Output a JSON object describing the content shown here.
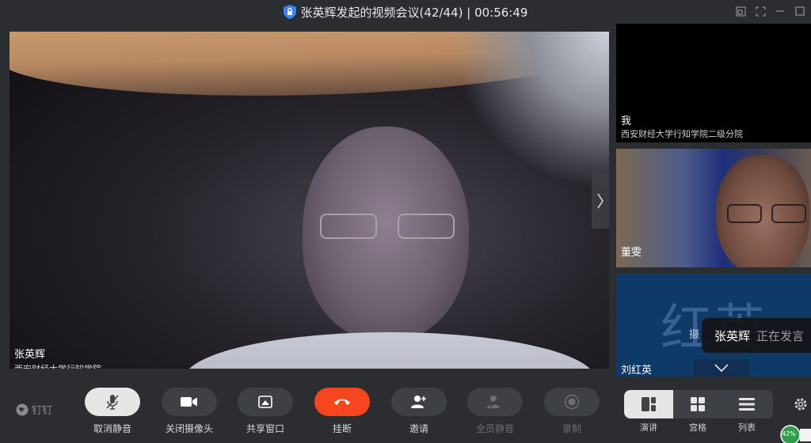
{
  "window": {
    "title": "张英辉发起的视频会议(42/44) | 00:56:49"
  },
  "main_video": {
    "name": "张英辉",
    "org": "西安财经大学行知学院"
  },
  "participants": [
    {
      "name": "我",
      "org": "西安财经大学行知学院二级分院"
    },
    {
      "name": "董雯"
    },
    {
      "name": "刘红英",
      "avatar_text": "红英",
      "hint": "摄"
    }
  ],
  "speaking": {
    "who": "张英辉",
    "status": "正在发言"
  },
  "toolbar": {
    "logo": "钉钉",
    "unmute": "取消静音",
    "camera_off": "关闭摄像头",
    "share": "共享窗口",
    "hangup": "挂断",
    "invite": "邀请",
    "mute_all": "全员静音",
    "record": "录制"
  },
  "layout": {
    "speaker": "演讲",
    "grid": "宫格",
    "list": "列表",
    "active": "speaker"
  },
  "network": {
    "percent": "42%"
  },
  "colors": {
    "hangup": "#f5461e",
    "toolbar_bg": "#2b2d30",
    "pill_bg": "#3d4044",
    "avatar_tile": "#0f3a68"
  }
}
